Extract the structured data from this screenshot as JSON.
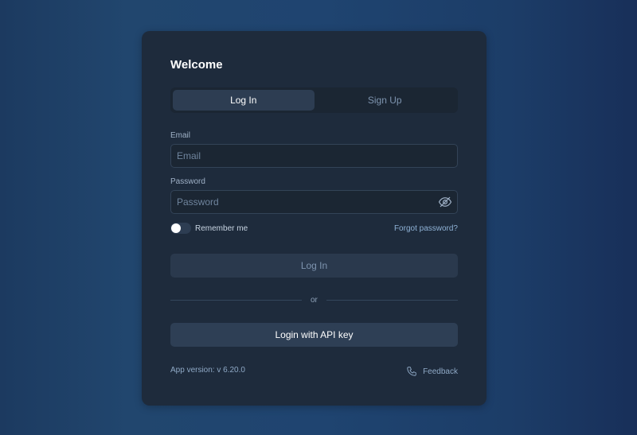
{
  "login_card": {
    "title": "Welcome",
    "tabs": [
      {
        "label": "Log In",
        "active": true
      },
      {
        "label": "Sign Up",
        "active": false
      }
    ],
    "email": {
      "label": "Email",
      "placeholder": "Email",
      "value": ""
    },
    "password": {
      "label": "Password",
      "placeholder": "Password",
      "value": "",
      "toggle_icon": "eye-off-icon"
    },
    "remember_me": {
      "label": "Remember me",
      "checked": false
    },
    "forgot_password": "Forgot password?",
    "login_button": "Log In",
    "divider_text": "or",
    "api_key_button": "Login with API key",
    "app_version": "App version: v 6.20.0",
    "feedback": {
      "label": "Feedback",
      "icon": "phone-icon"
    }
  },
  "colors": {
    "card_background": "#1e2b3c",
    "accent_link": "#8fb2d6",
    "active_tab": "#2d3d52"
  }
}
